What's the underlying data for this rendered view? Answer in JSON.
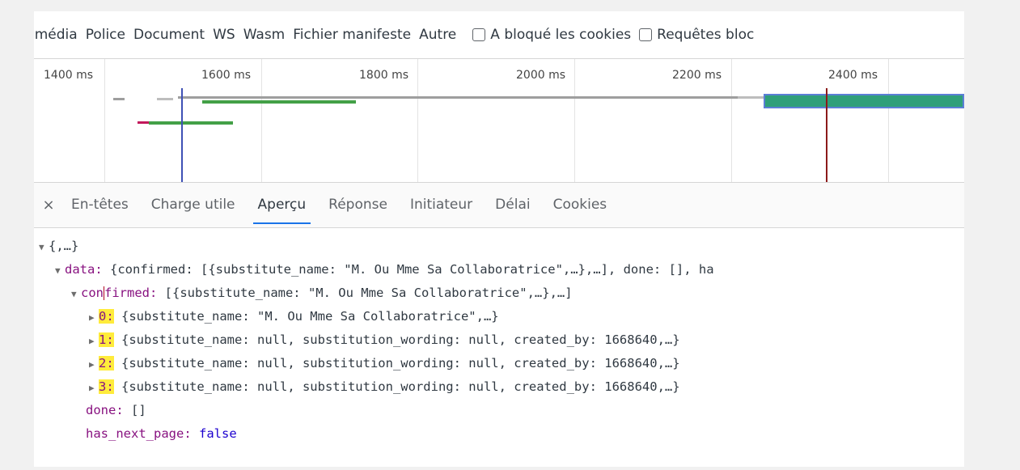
{
  "filters": {
    "items": [
      "imédia",
      "Police",
      "Document",
      "WS",
      "Wasm",
      "Fichier manifeste",
      "Autre"
    ],
    "checkboxes": [
      "A bloqué les cookies",
      "Requêtes bloc"
    ]
  },
  "timeline": {
    "ticks": [
      "1400 ms",
      "1600 ms",
      "1800 ms",
      "2000 ms",
      "2200 ms",
      "2400 ms"
    ]
  },
  "tabs": {
    "close_icon": "×",
    "items": [
      "En-têtes",
      "Charge utile",
      "Aperçu",
      "Réponse",
      "Initiateur",
      "Délai",
      "Cookies"
    ],
    "active": "Aperçu"
  },
  "preview": {
    "root": "{,…}",
    "data_key": "data:",
    "data_summary": "{confirmed: [{substitute_name: \"M. Ou Mme Sa Collaboratrice\",…},…], done: [], ha",
    "confirmed_key_a": "con",
    "confirmed_key_b": "firmed:",
    "confirmed_summary": "[{substitute_name: \"M. Ou Mme Sa Collaboratrice\",…},…]",
    "items": [
      {
        "index": "0:",
        "summary": "{substitute_name: \"M. Ou Mme Sa Collaboratrice\",…}"
      },
      {
        "index": "1:",
        "summary": "{substitute_name: null, substitution_wording: null, created_by: 1668640,…}"
      },
      {
        "index": "2:",
        "summary": "{substitute_name: null, substitution_wording: null, created_by: 1668640,…}"
      },
      {
        "index": "3:",
        "summary": "{substitute_name: null, substitution_wording: null, created_by: 1668640,…}"
      }
    ],
    "done_key": "done:",
    "done_value": "[]",
    "has_next_key": "has_next_page:",
    "has_next_value": "false"
  }
}
